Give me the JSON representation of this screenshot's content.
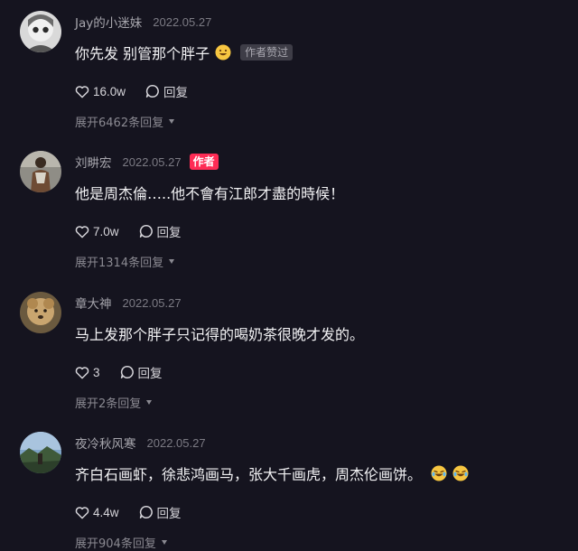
{
  "comments": [
    {
      "username": "Jay的小迷妹",
      "date": "2022.05.27",
      "text": "你先发 别管那个胖子",
      "emoji": "grinning-face",
      "liked_badge": "作者赞过",
      "likes": "16.0w",
      "reply_label": "回复",
      "expand_label": "展开6462条回复"
    },
    {
      "username": "刘畊宏",
      "date": "2022.05.27",
      "author_badge": "作者",
      "text": "他是周杰倫…..他不會有江郎才盡的時候！",
      "likes": "7.0w",
      "reply_label": "回复",
      "expand_label": "展开1314条回复"
    },
    {
      "username": "章大神",
      "date": "2022.05.27",
      "text": "马上发那个胖子只记得的喝奶茶很晚才发的。",
      "likes": "3",
      "reply_label": "回复",
      "expand_label": "展开2条回复"
    },
    {
      "username": "夜冷秋风寒",
      "date": "2022.05.27",
      "text": "齐白石画虾，徐悲鸿画马，张大千画虎，周杰伦画饼。",
      "emoji": "laughing-tears",
      "likes": "4.4w",
      "reply_label": "回复",
      "expand_label": "展开904条回复"
    }
  ]
}
